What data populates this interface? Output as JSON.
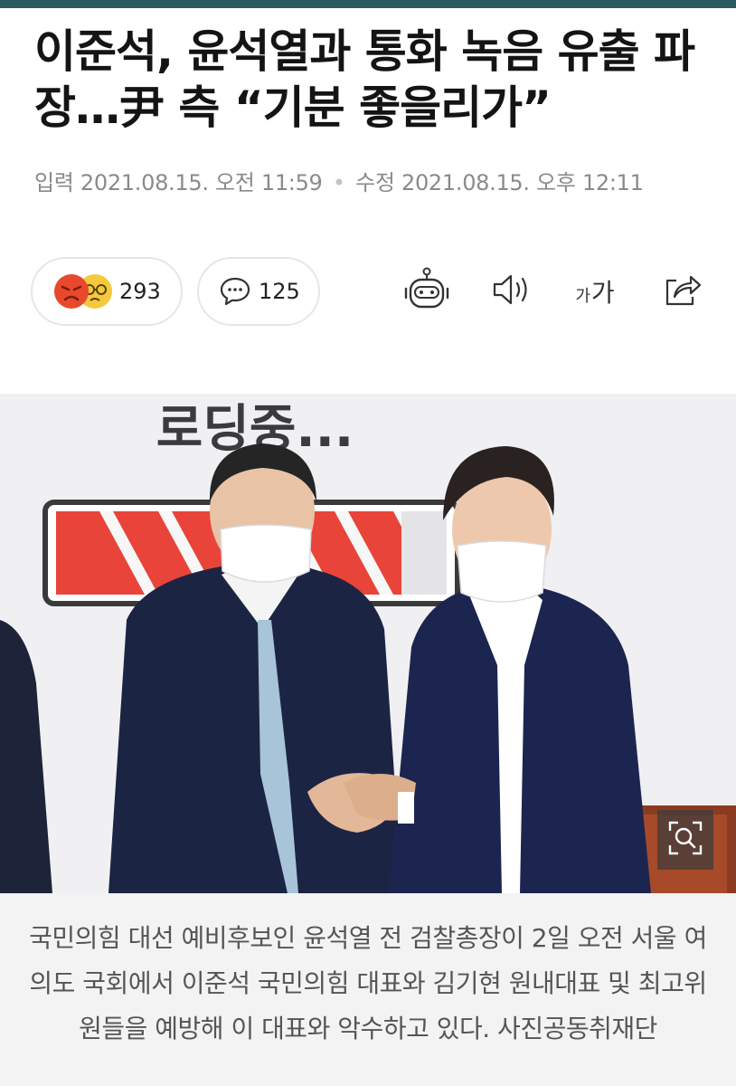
{
  "article": {
    "headline": "이준석, 윤석열과 통화 녹음 유출 파장…尹 측 “기분 좋을리가”",
    "published_label": "입력",
    "published": "2021.08.15. 오전 11:59",
    "separator": "•",
    "modified_label": "수정",
    "modified": "2021.08.15. 오후 12:11"
  },
  "reactions": {
    "emoji_icons": [
      "angry-face-icon",
      "sad-face-icon"
    ],
    "count": "293"
  },
  "comments": {
    "icon": "speech-bubble-icon",
    "count": "125"
  },
  "toolbar": {
    "icons": [
      "robot-summary-icon",
      "speaker-icon",
      "font-size-icon",
      "share-icon"
    ],
    "font_small": "가",
    "font_large": "가"
  },
  "photo": {
    "sign_text": "로딩중...",
    "zoom_icon": "zoom-icon"
  },
  "caption": "국민의힘 대선 예비후보인 윤석열 전 검찰총장이 2일 오전 서울 여의도 국회에서 이준석 국민의힘 대표와 김기현 원내대표 및 최고위원들을 예방해 이 대표와 악수하고 있다. 사진공동취재단",
  "colors": {
    "topbar": "#2b5a60",
    "meta_text": "#8a8a8a",
    "battery_red": "#e8443a",
    "suit_navy": "#1c2444"
  }
}
